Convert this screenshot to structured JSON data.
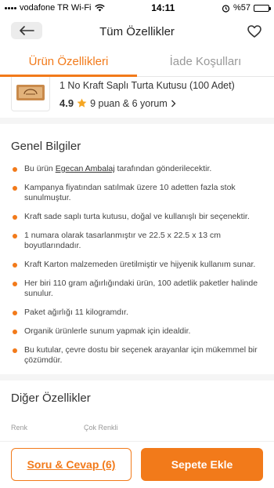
{
  "status_bar": {
    "carrier": "vodafone TR Wi-Fi",
    "time": "14:11",
    "battery": "%57",
    "battery_level": 0.57
  },
  "nav": {
    "title": "Tüm Özellikler"
  },
  "tabs": [
    {
      "label": "Ürün Özellikleri",
      "active": true
    },
    {
      "label": "İade Koşulları",
      "active": false
    }
  ],
  "product": {
    "name": "1 No Kraft Saplı Turta Kutusu (100 Adet)",
    "rating": "4.9",
    "rating_text": "9 puan & 6 yorum"
  },
  "general_info": {
    "title": "Genel Bilgiler",
    "seller_prefix": "Bu ürün ",
    "seller_name": "Egecan Ambalaj",
    "seller_suffix": " tarafından gönderilecektir.",
    "items": [
      "Kampanya fiyatından satılmak üzere 10 adetten fazla stok sunulmuştur.",
      "Kraft sade saplı turta kutusu, doğal ve kullanışlı bir seçenektir.",
      "1 numara olarak tasarlanmıştır ve 22.5 x 22.5 x 13 cm boyutlarındadır.",
      "Kraft Karton malzemeden üretilmiştir ve hijyenik kullanım sunar.",
      "Her biri 110 gram ağırlığındaki ürün, 100 adetlik paketler halinde sunulur.",
      "Paket ağırlığı 11 kilogramdır.",
      "Organik ürünlerle sunum yapmak için idealdir.",
      "Bu kutular, çevre dostu bir seçenek arayanlar için mükemmel bir çözümdür."
    ]
  },
  "other_features": {
    "title": "Diğer Özellikler",
    "row_label": "Renk",
    "row_value": "Çok Renkli"
  },
  "bottom_bar": {
    "qa_label": "Soru & Cevap (6)",
    "cart_label": "Sepete Ekle"
  },
  "colors": {
    "accent": "#f27a1a",
    "star": "#f5a623"
  }
}
